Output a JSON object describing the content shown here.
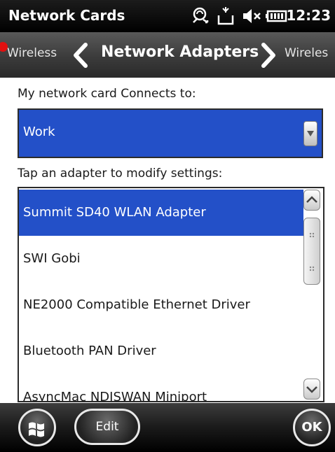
{
  "window": {
    "title": "Network Cards",
    "clock": "12:23"
  },
  "status_icons": [
    "connectivity-icon",
    "message-icon",
    "volume-muted-icon",
    "battery-icon"
  ],
  "tabs": {
    "previous": "Wireless",
    "current": "Network Adapters",
    "next": "Wireles"
  },
  "connects_to": {
    "label": "My network card Connects to:",
    "selected": "Work"
  },
  "adapters": {
    "label": "Tap an adapter to modify settings:",
    "items": [
      {
        "label": "Summit SD40 WLAN Adapter",
        "selected": true
      },
      {
        "label": "SWI Gobi",
        "selected": false
      },
      {
        "label": "NE2000 Compatible Ethernet Driver",
        "selected": false
      },
      {
        "label": "Bluetooth PAN Driver",
        "selected": false
      },
      {
        "label": "AsyncMac NDISWAN Miniport",
        "selected": false
      }
    ]
  },
  "bottom_bar": {
    "start_icon": "windows-flag-icon",
    "edit_label": "Edit",
    "ok_label": "OK"
  },
  "colors": {
    "selection": "#2350c8",
    "marker": "#e01010"
  }
}
